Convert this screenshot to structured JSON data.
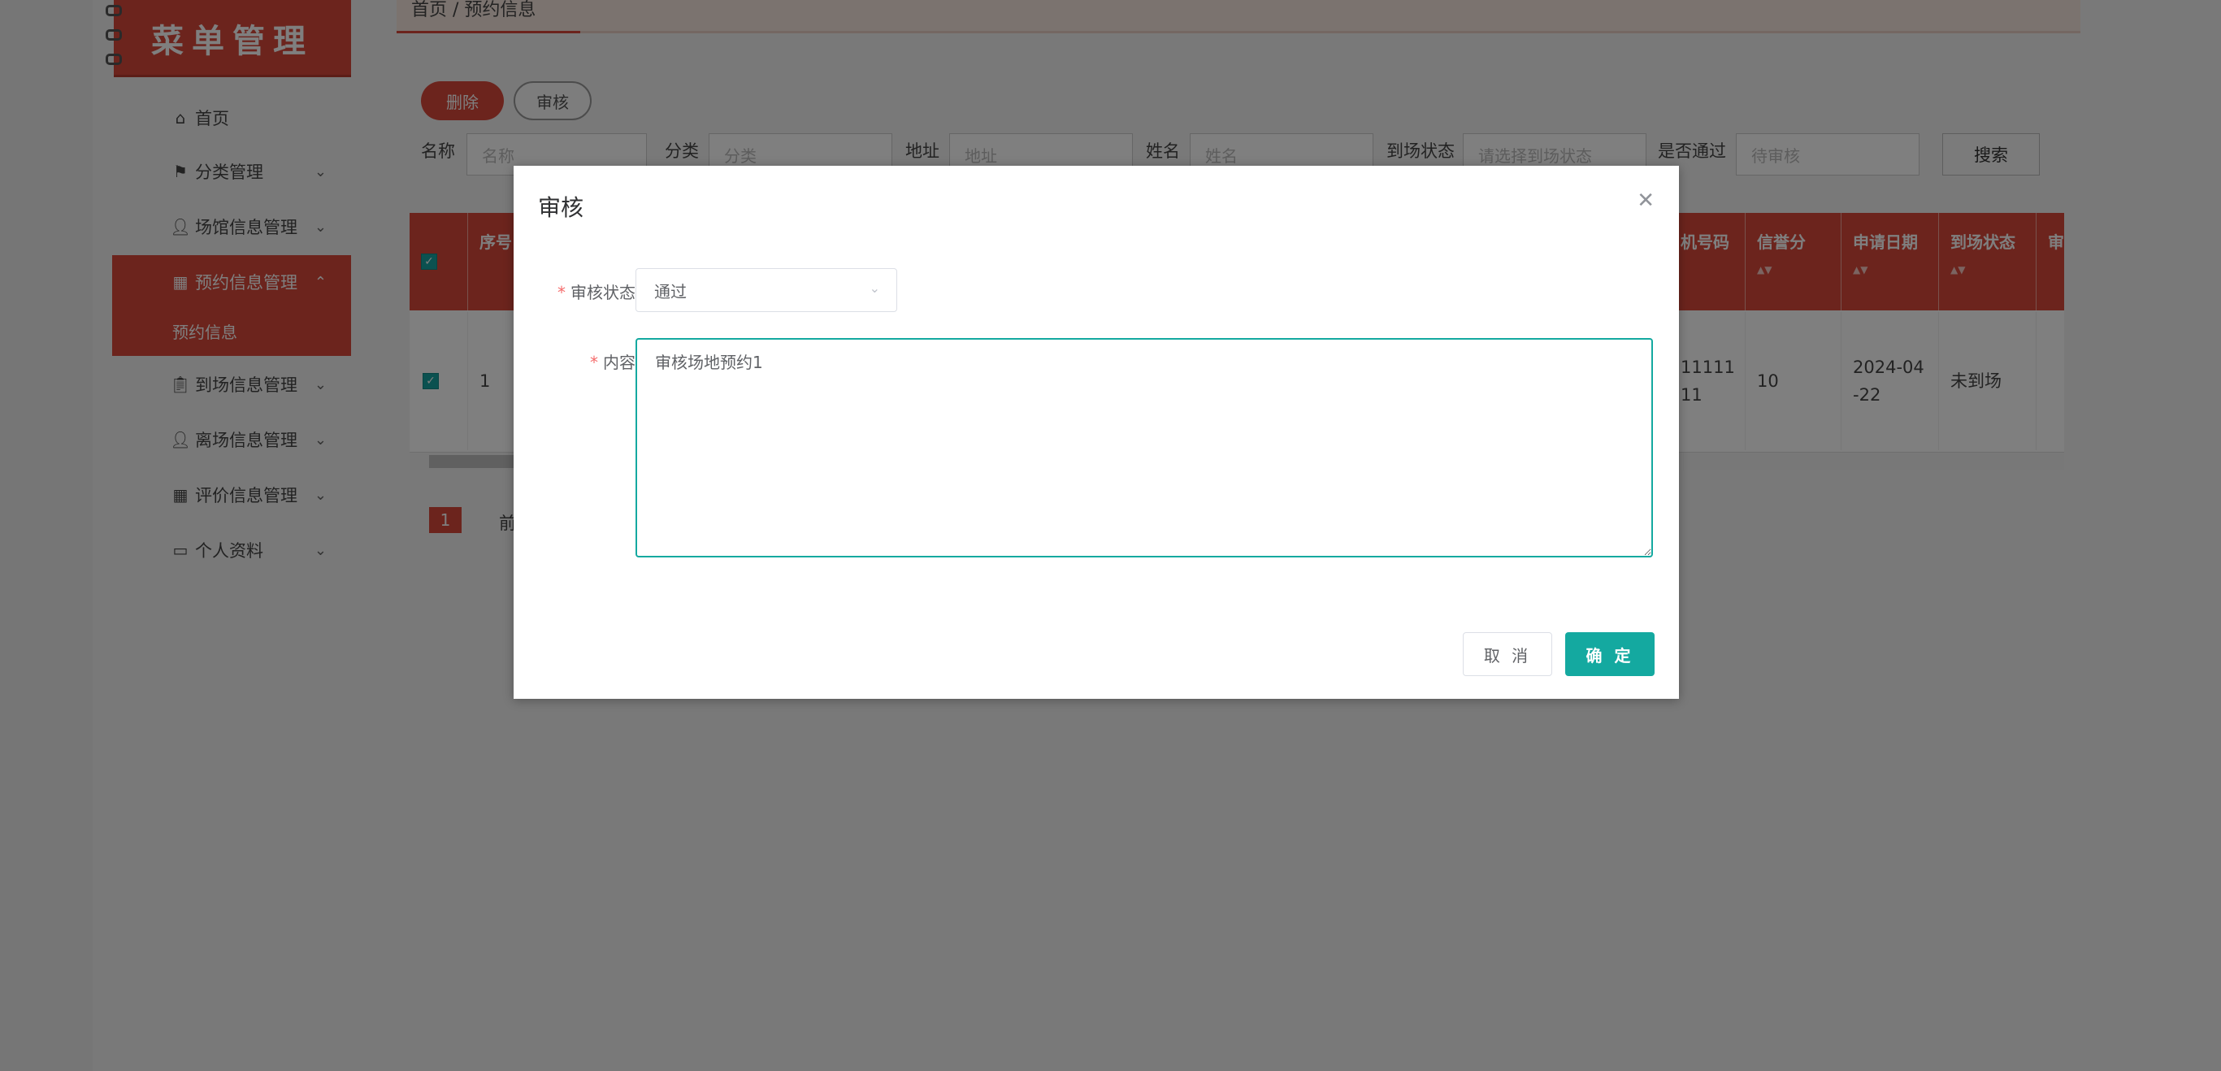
{
  "sidebar": {
    "logo_title": "菜单管理",
    "items": [
      {
        "label": "首页",
        "icon": "home-icon"
      },
      {
        "label": "分类管理",
        "icon": "flag-icon"
      },
      {
        "label": "场馆信息管理",
        "icon": "user-icon"
      },
      {
        "label": "预约信息管理",
        "icon": "grid-icon",
        "active": true
      },
      {
        "label": "到场信息管理",
        "icon": "clipboard-icon"
      },
      {
        "label": "离场信息管理",
        "icon": "user-icon"
      },
      {
        "label": "评价信息管理",
        "icon": "grid-icon"
      },
      {
        "label": "个人资料",
        "icon": "profile-card-icon"
      }
    ],
    "submenu_label": "预约信息"
  },
  "breadcrumb": "首页 / 预约信息",
  "toolbar": {
    "delete_label": "删除",
    "audit_label": "审核"
  },
  "search": {
    "name_label": "名称",
    "name_placeholder": "名称",
    "category_label": "分类",
    "category_placeholder": "分类",
    "address_label": "地址",
    "address_placeholder": "地址",
    "person_label": "姓名",
    "person_placeholder": "姓名",
    "arrival_label": "到场状态",
    "arrival_placeholder": "请选择到场状态",
    "passed_label": "是否通过",
    "passed_value": "待审核",
    "search_button": "搜索"
  },
  "table": {
    "headers": [
      "序号",
      "机号码",
      "信誉分",
      "申请日期",
      "到场状态",
      "审"
    ],
    "row": {
      "index": "1",
      "phone": "11111\n11",
      "credit": "10",
      "date": "2024-04-22",
      "date_line1": "2024-04",
      "date_line2": "-22",
      "arrival": "未到场"
    }
  },
  "pagination": {
    "current": "1",
    "prev": "前"
  },
  "dialog": {
    "title": "审核",
    "status_label": "审核状态",
    "status_value": "通过",
    "content_label": "内容",
    "content_value": "审核场地预约1",
    "cancel_label": "取 消",
    "ok_label": "确 定"
  },
  "colors": {
    "brand": "#d9483b",
    "accent": "#14a9a0"
  }
}
